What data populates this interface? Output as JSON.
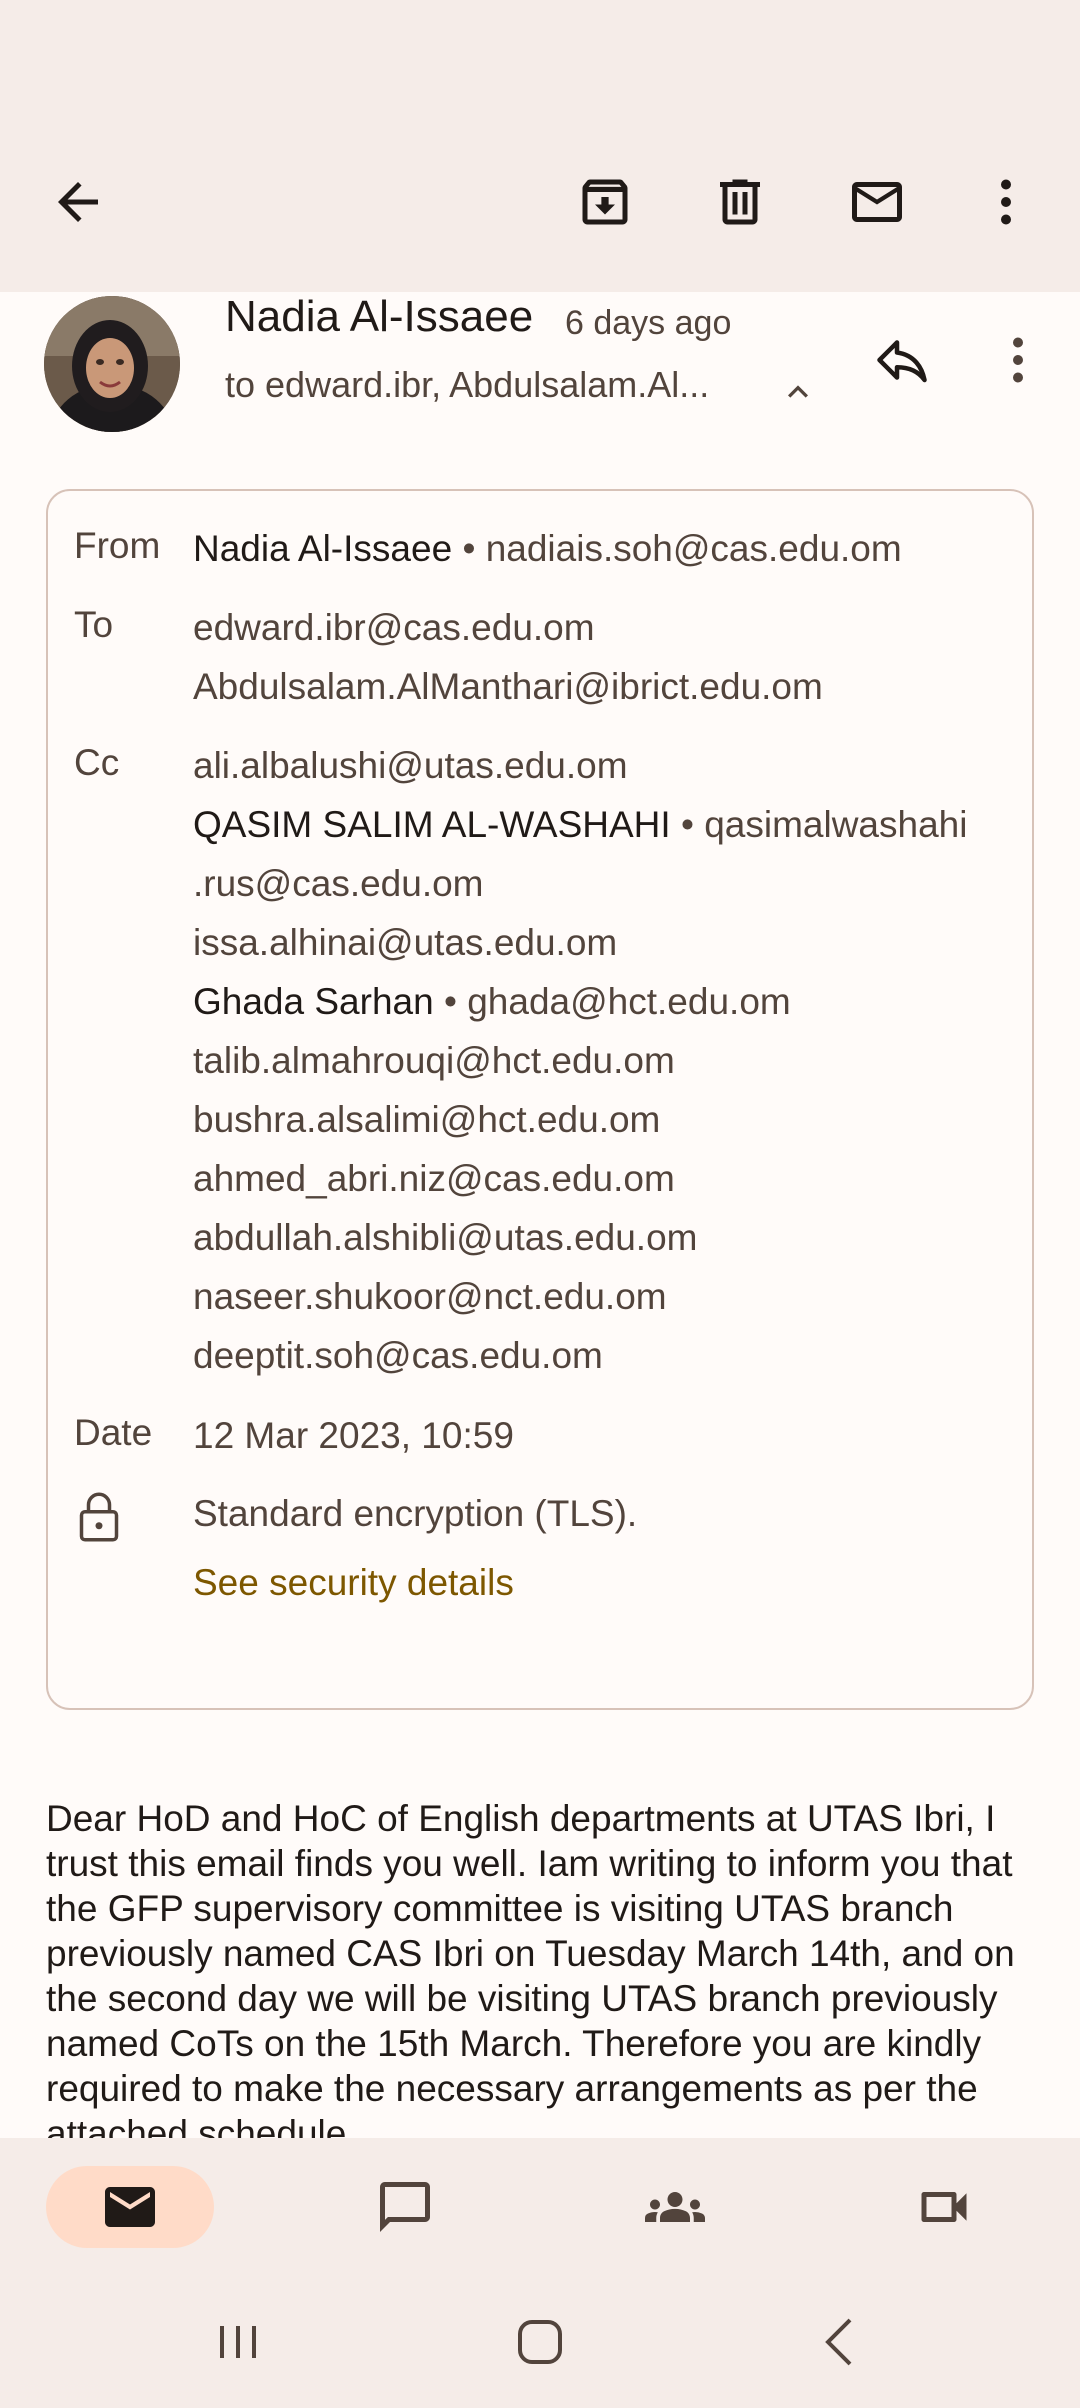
{
  "sender": {
    "name": "Nadia Al-Issaee",
    "time": "6 days ago",
    "to_summary": "to edward.ibr, Abdulsalam.Al..."
  },
  "details": {
    "from_label": "From",
    "from_name": "Nadia Al-Issaee",
    "from_email": "nadiais.soh@cas.edu.om",
    "to_label": "To",
    "to": [
      "edward.ibr@cas.edu.om",
      "Abdulsalam.AlManthari@ibrict.edu.om"
    ],
    "cc_label": "Cc",
    "cc": {
      "c1": "ali.albalushi@utas.edu.om",
      "c2_name": "QASIM SALIM AL-WASHAHI",
      "c2_email_a": "qasimalwashahi",
      "c2_email_b": ".rus@cas.edu.om",
      "c3": "issa.alhinai@utas.edu.om",
      "c4_name": "Ghada Sarhan",
      "c4_email": "ghada@hct.edu.om",
      "c5": "talib.almahrouqi@hct.edu.om",
      "c6": "bushra.alsalimi@hct.edu.om",
      "c7": "ahmed_abri.niz@cas.edu.om",
      "c8": "abdullah.alshibli@utas.edu.om",
      "c9": "naseer.shukoor@nct.edu.om",
      "c10": "deeptit.soh@cas.edu.om"
    },
    "date_label": "Date",
    "date": "12 Mar 2023, 10:59",
    "security_text": "Standard encryption (TLS).",
    "security_link": "See security details",
    "separator": "•"
  },
  "body": {
    "text": "Dear HoD and HoC of English departments at UTAS Ibri, I trust this email finds you well. Iam writing to inform you that the GFP supervisory committee is visiting UTAS branch previously named CAS Ibri on Tuesday March 14th, and on the second day we will be visiting UTAS branch previously named CoTs on the 15th March. Therefore you are kindly required to make the necessary arrangements as per the attached schedule"
  },
  "icons": {
    "back": "arrow-back-icon",
    "archive": "archive-icon",
    "delete": "trash-icon",
    "mark_unread": "mail-icon",
    "more": "more-vert-icon",
    "reply": "reply-icon",
    "lock": "lock-icon",
    "nav_mail": "mail-icon",
    "nav_chat": "chat-icon",
    "nav_spaces": "people-icon",
    "nav_meet": "video-icon"
  },
  "colors": {
    "accent": "#7d5700",
    "nav_active": "#ffdbc8",
    "surface": "#f5ece8"
  }
}
